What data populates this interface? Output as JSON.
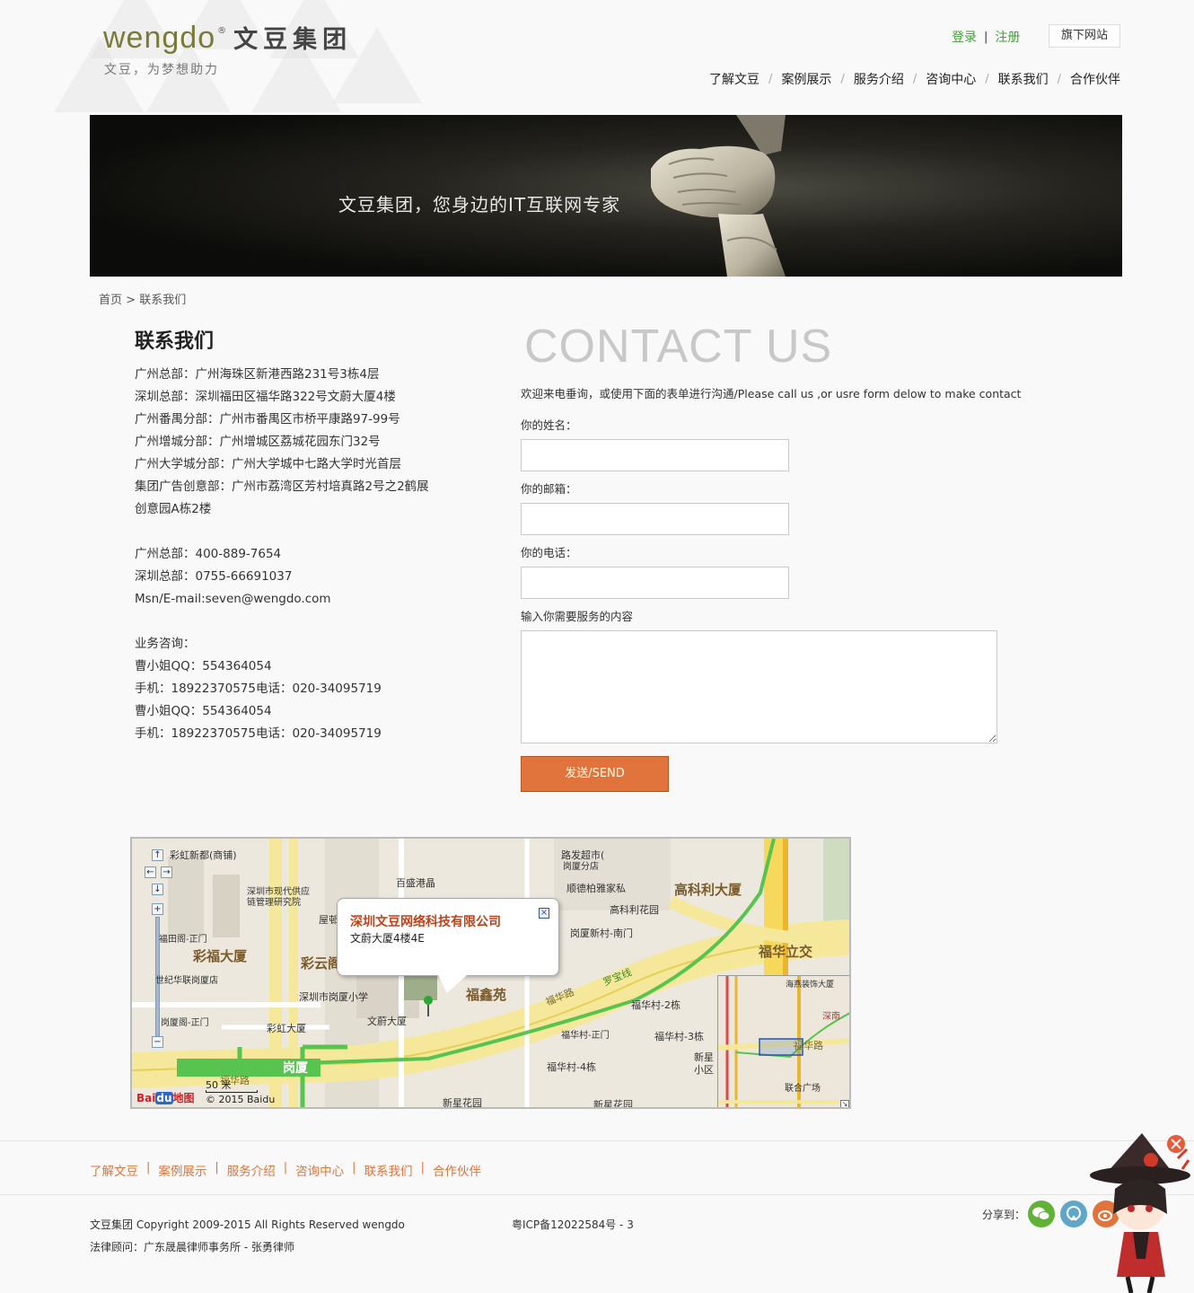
{
  "header": {
    "logo_word": "wengdo",
    "logo_reg": "®",
    "logo_cn": "文豆集团",
    "slogan": "文豆，为梦想助力",
    "login": "登录",
    "divider": "|",
    "register": "注册",
    "subsite": "旗下网站"
  },
  "nav": {
    "items": [
      "了解文豆",
      "案例展示",
      "服务介绍",
      "咨询中心",
      "联系我们",
      "合作伙伴"
    ],
    "separator": "/"
  },
  "banner": {
    "text": "文豆集团，您身边的IT互联网专家"
  },
  "breadcrumb": {
    "home": "首页",
    "sep": ">",
    "current": "联系我们"
  },
  "contact": {
    "title": "联系我们",
    "addresses": [
      "广州总部：广州海珠区新港西路231号3栋4层",
      "深圳总部：深圳福田区福华路322号文蔚大厦4楼",
      "广州番禺分部：广州市番禺区市桥平康路97-99号",
      "广州增城分部：广州增城区荔城花园东门32号",
      "广州大学城分部：广州大学城中七路大学时光首层",
      "集团广告创意部：广州市荔湾区芳村培真路2号之2鹤展",
      "创意园A栋2楼"
    ],
    "phones": [
      "广州总部：400-889-7654",
      "深圳总部：0755-66691037",
      "Msn/E-mail:seven@wengdo.com"
    ],
    "business": [
      "业务咨询：",
      "曹小姐QQ：554364054",
      "手机：18922370575电话：020-34095719",
      "曹小姐QQ：554364054",
      "手机：18922370575电话：020-34095719"
    ]
  },
  "form": {
    "big_title": "CONTACT US",
    "intro": "欢迎来电垂询，或使用下面的表单进行沟通/Please call us ,or usre form delow to make contact",
    "name_label": "你的姓名：",
    "email_label": "你的邮箱：",
    "phone_label": "你的电话：",
    "content_label": "输入你需要服务的内容",
    "submit": "发送/SEND",
    "accent_color": "#e0743c"
  },
  "map": {
    "popup_title": "深圳文豆网络科技有限公司",
    "popup_address": "文蔚大厦4楼4E",
    "labels": {
      "l1": "彩虹新都(商铺)",
      "l2": "路发超市(",
      "l3": "岗厦分店",
      "l4": "百盛港晶",
      "l5": "深圳市现代供应",
      "l6": "链管理研究院",
      "l7": "屋邨",
      "l8": "顺德柏雅家私",
      "l9": "高科利大厦",
      "l10": "高科利花园",
      "l11": "岗厦新村-南门",
      "l12": "福华立交",
      "l13": "福田阁-正门",
      "l14": "彩福大厦",
      "l15": "彩云阁",
      "l16": "世纪华联岗厦店",
      "l17": "深圳市岗厦小学",
      "l18": "福鑫苑",
      "l19": "文蔚大厦",
      "l20": "彩虹大厦",
      "l21": "福华村-2栋",
      "l22": "福华村-正门",
      "l23": "福华村-3栋",
      "l24": "新星",
      "l25": "小区",
      "l26": "福华村-4栋",
      "l27": "岗厦",
      "l28": "福华路",
      "l29": "罗宝线",
      "l30": "新星花园",
      "l31": "新星花园",
      "l32": "福华路",
      "l33": "岗厦阁-正门",
      "l34": "海燕装饰大厦",
      "l35": "深南",
      "l36": "福华路",
      "l37": "联合广场",
      "l38": "福华路"
    },
    "scale": "50 米",
    "brand": "Bai",
    "brand_du": "du",
    "brand_suffix": "地图",
    "copyright": "© 2015 Baidu"
  },
  "footer": {
    "nav": [
      "了解文豆",
      "案例展示",
      "服务介绍",
      "咨询中心",
      "联系我们",
      "合作伙伴"
    ],
    "separator": "|",
    "copyright": "文豆集团 Copyright 2009-2015 All Rights Reserved wengdo",
    "icp": "粤ICP备12022584号 - 3",
    "legal": "法律顾问：广东晟晨律师事务所 - 张勇律师",
    "share_label": "分享到：",
    "share_icons": [
      "wechat-icon",
      "qzone-icon",
      "weibo-icon"
    ]
  }
}
